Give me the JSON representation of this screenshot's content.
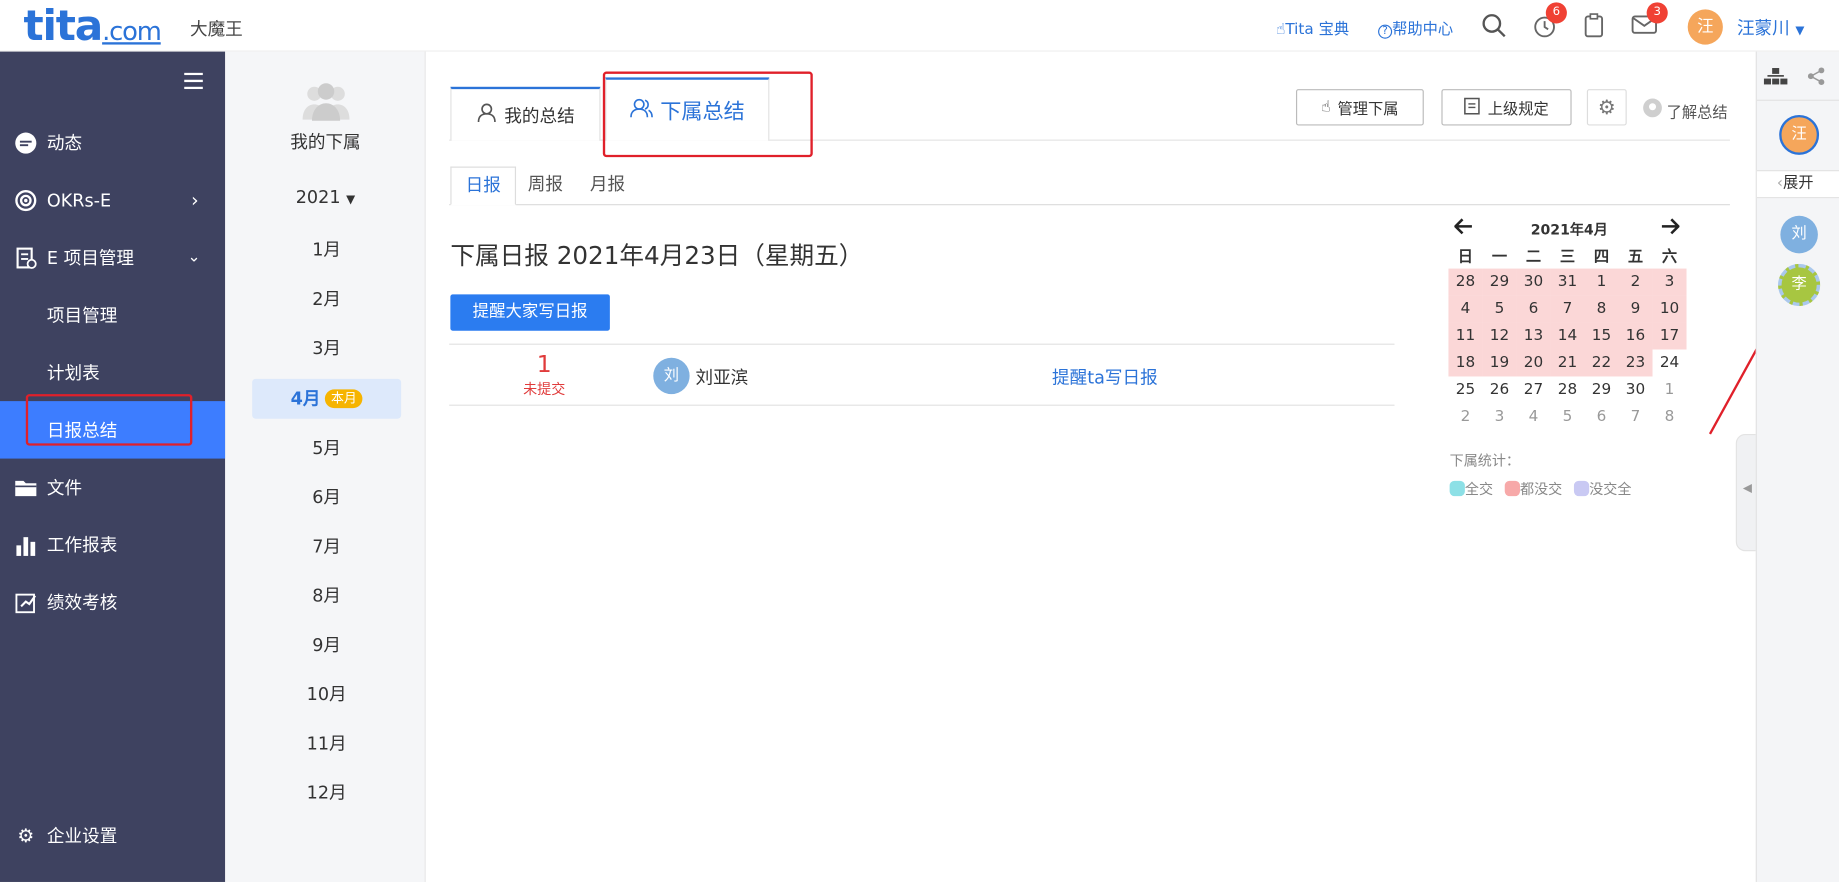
{
  "header": {
    "logo_main": "tita",
    "logo_suffix": ".com",
    "company": "大魔王",
    "link_guide": "Tita 宝典",
    "link_help": "帮助中心",
    "badge_alarm": "6",
    "badge_mail": "3",
    "user_initial": "汪",
    "user_name": "汪蒙川"
  },
  "sidebar": {
    "items": [
      {
        "label": "动态"
      },
      {
        "label": "OKRs-E"
      },
      {
        "label": "E 项目管理"
      },
      {
        "label": "项目管理"
      },
      {
        "label": "计划表"
      },
      {
        "label": "日报总结"
      },
      {
        "label": "文件"
      },
      {
        "label": "工作报表"
      },
      {
        "label": "绩效考核"
      }
    ],
    "settings": "企业设置"
  },
  "months": {
    "title": "我的下属",
    "year": "2021",
    "list": [
      "1月",
      "2月",
      "3月",
      "4月",
      "5月",
      "6月",
      "7月",
      "8月",
      "9月",
      "10月",
      "11月",
      "12月"
    ],
    "current_tag": "本月"
  },
  "tabs": {
    "mine": "我的总结",
    "subordinate": "下属总结"
  },
  "toolbar": {
    "manage": "管理下属",
    "rules": "上级规定",
    "learn": "了解总结"
  },
  "subtabs": [
    "日报",
    "周报",
    "月报"
  ],
  "report": {
    "title": "下属日报 2021年4月23日（星期五）",
    "remind_all": "提醒大家写日报",
    "count": "1",
    "count_label": "未提交",
    "person_initial": "刘",
    "person_name": "刘亚滨",
    "remind_one": "提醒ta写日报"
  },
  "calendar": {
    "title": "2021年4月",
    "weekdays": [
      "日",
      "一",
      "二",
      "三",
      "四",
      "五",
      "六"
    ],
    "weeks": [
      [
        "28",
        "29",
        "30",
        "31",
        "1",
        "2",
        "3"
      ],
      [
        "4",
        "5",
        "6",
        "7",
        "8",
        "9",
        "10"
      ],
      [
        "11",
        "12",
        "13",
        "14",
        "15",
        "16",
        "17"
      ],
      [
        "18",
        "19",
        "20",
        "21",
        "22",
        "23",
        "24"
      ],
      [
        "25",
        "26",
        "27",
        "28",
        "29",
        "30",
        "1"
      ],
      [
        "2",
        "3",
        "4",
        "5",
        "6",
        "7",
        "8"
      ]
    ],
    "stats_label": "下属统计：",
    "legend": [
      {
        "label": "全交",
        "color": "#8de0e6"
      },
      {
        "label": "都没交",
        "color": "#f7a9a9"
      },
      {
        "label": "没交全",
        "color": "#c9c9f3"
      }
    ]
  },
  "rightpanel": {
    "me": "汪",
    "expand": "展开",
    "p1": "刘",
    "p2": "李"
  },
  "colors": {
    "sidebar_bg": "#3e4260",
    "accent": "#3d7dff",
    "link": "#2b73d8"
  }
}
